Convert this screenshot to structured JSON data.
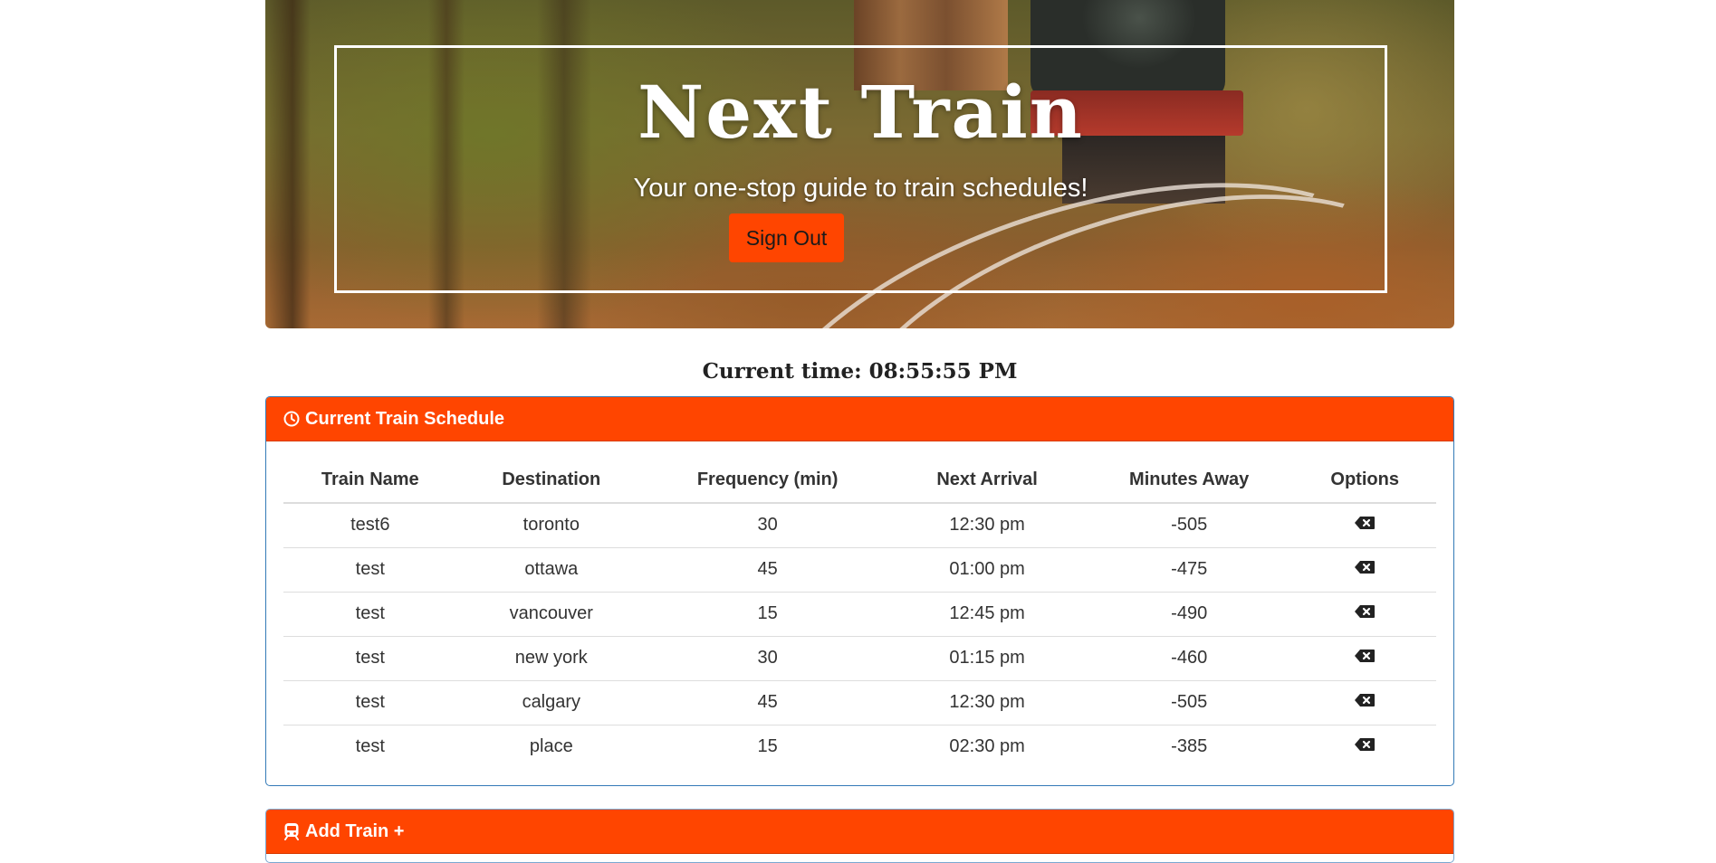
{
  "hero": {
    "title": "Next Train",
    "subtitle": "Your one-stop guide to train schedules!",
    "signout_label": "Sign Out"
  },
  "current_time": {
    "text": "Current time: 08:55:55 PM"
  },
  "schedule": {
    "heading": "Current Train Schedule",
    "heading_icon": "clock-icon",
    "columns": [
      "Train Name",
      "Destination",
      "Frequency (min)",
      "Next Arrival",
      "Minutes Away",
      "Options"
    ],
    "rows": [
      {
        "name": "test6",
        "destination": "toronto",
        "frequency": "30",
        "next_arrival": "12:30 pm",
        "minutes_away": "-505",
        "option_icon": "delete-icon"
      },
      {
        "name": "test",
        "destination": "ottawa",
        "frequency": "45",
        "next_arrival": "01:00 pm",
        "minutes_away": "-475",
        "option_icon": "delete-icon"
      },
      {
        "name": "test",
        "destination": "vancouver",
        "frequency": "15",
        "next_arrival": "12:45 pm",
        "minutes_away": "-490",
        "option_icon": "delete-icon"
      },
      {
        "name": "test",
        "destination": "new york",
        "frequency": "30",
        "next_arrival": "01:15 pm",
        "minutes_away": "-460",
        "option_icon": "delete-icon"
      },
      {
        "name": "test",
        "destination": "calgary",
        "frequency": "45",
        "next_arrival": "12:30 pm",
        "minutes_away": "-505",
        "option_icon": "delete-icon"
      },
      {
        "name": "test",
        "destination": "place",
        "frequency": "15",
        "next_arrival": "02:30 pm",
        "minutes_away": "-385",
        "option_icon": "delete-icon"
      }
    ]
  },
  "add_train": {
    "heading": "Add Train +",
    "heading_icon": "train-icon"
  },
  "colors": {
    "accent": "#ff4500",
    "panel_border": "#337ab7"
  }
}
